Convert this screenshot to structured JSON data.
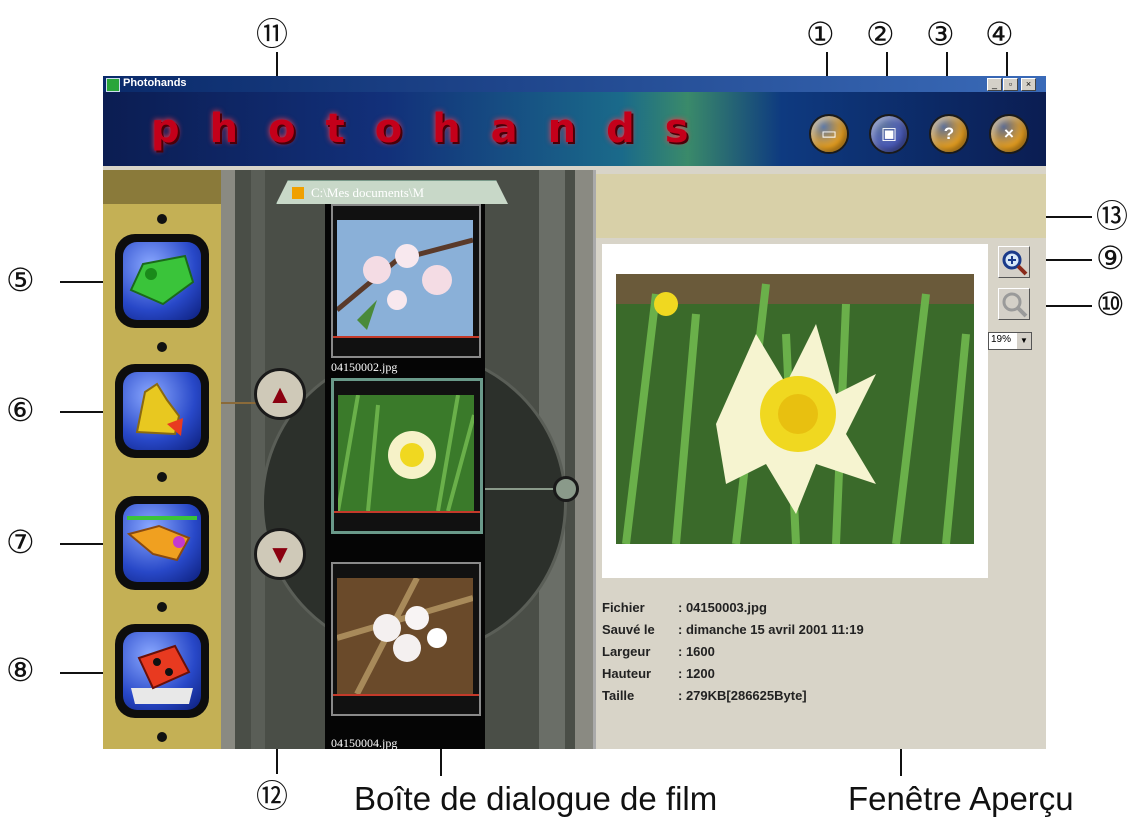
{
  "window": {
    "title": "Photohands",
    "logo_text": "photohands",
    "controls": {
      "minimize": "_",
      "restore": "▫",
      "close": "×"
    }
  },
  "toolbar": [
    {
      "name": "open-button",
      "icon": "folder-icon",
      "glyph": "▭",
      "color": "#e8a020"
    },
    {
      "name": "save-button",
      "icon": "disk-icon",
      "glyph": "▣",
      "color": "#4a5ab8"
    },
    {
      "name": "help-button",
      "icon": "question-icon",
      "glyph": "?",
      "color": "#e8a020"
    },
    {
      "name": "exit-button",
      "icon": "close-icon",
      "glyph": "×",
      "color": "#e8a020"
    }
  ],
  "modes": [
    {
      "name": "mode-button-1",
      "icon": "chameleon-icon",
      "color": "#3ac43a"
    },
    {
      "name": "mode-button-2",
      "icon": "giraffe-icon",
      "color": "#e8c820"
    },
    {
      "name": "mode-button-3",
      "icon": "fish-icon",
      "color": "#f0a020"
    },
    {
      "name": "mode-button-4",
      "icon": "dice-icon",
      "color": "#e83a20"
    }
  ],
  "film": {
    "path": "C:\\Mes documents\\M",
    "files": [
      "04150002.jpg",
      "04150004.jpg"
    ]
  },
  "preview": {
    "zoom": "19%",
    "info": [
      {
        "label": "Fichier",
        "value": ": 04150003.jpg"
      },
      {
        "label": "Sauvé le",
        "value": ": dimanche 15 avril 2001 11:19"
      },
      {
        "label": "Largeur",
        "value": ": 1600"
      },
      {
        "label": "Hauteur",
        "value": ": 1200"
      },
      {
        "label": "Taille",
        "value": ": 279KB[286625Byte]"
      }
    ]
  },
  "callouts": [
    "①",
    "②",
    "③",
    "④",
    "⑤",
    "⑥",
    "⑦",
    "⑧",
    "⑨",
    "⑩",
    "⑪",
    "⑫",
    "⑬"
  ],
  "captions": {
    "film": "Boîte de dialogue de film",
    "preview": "Fenêtre Aperçu"
  }
}
